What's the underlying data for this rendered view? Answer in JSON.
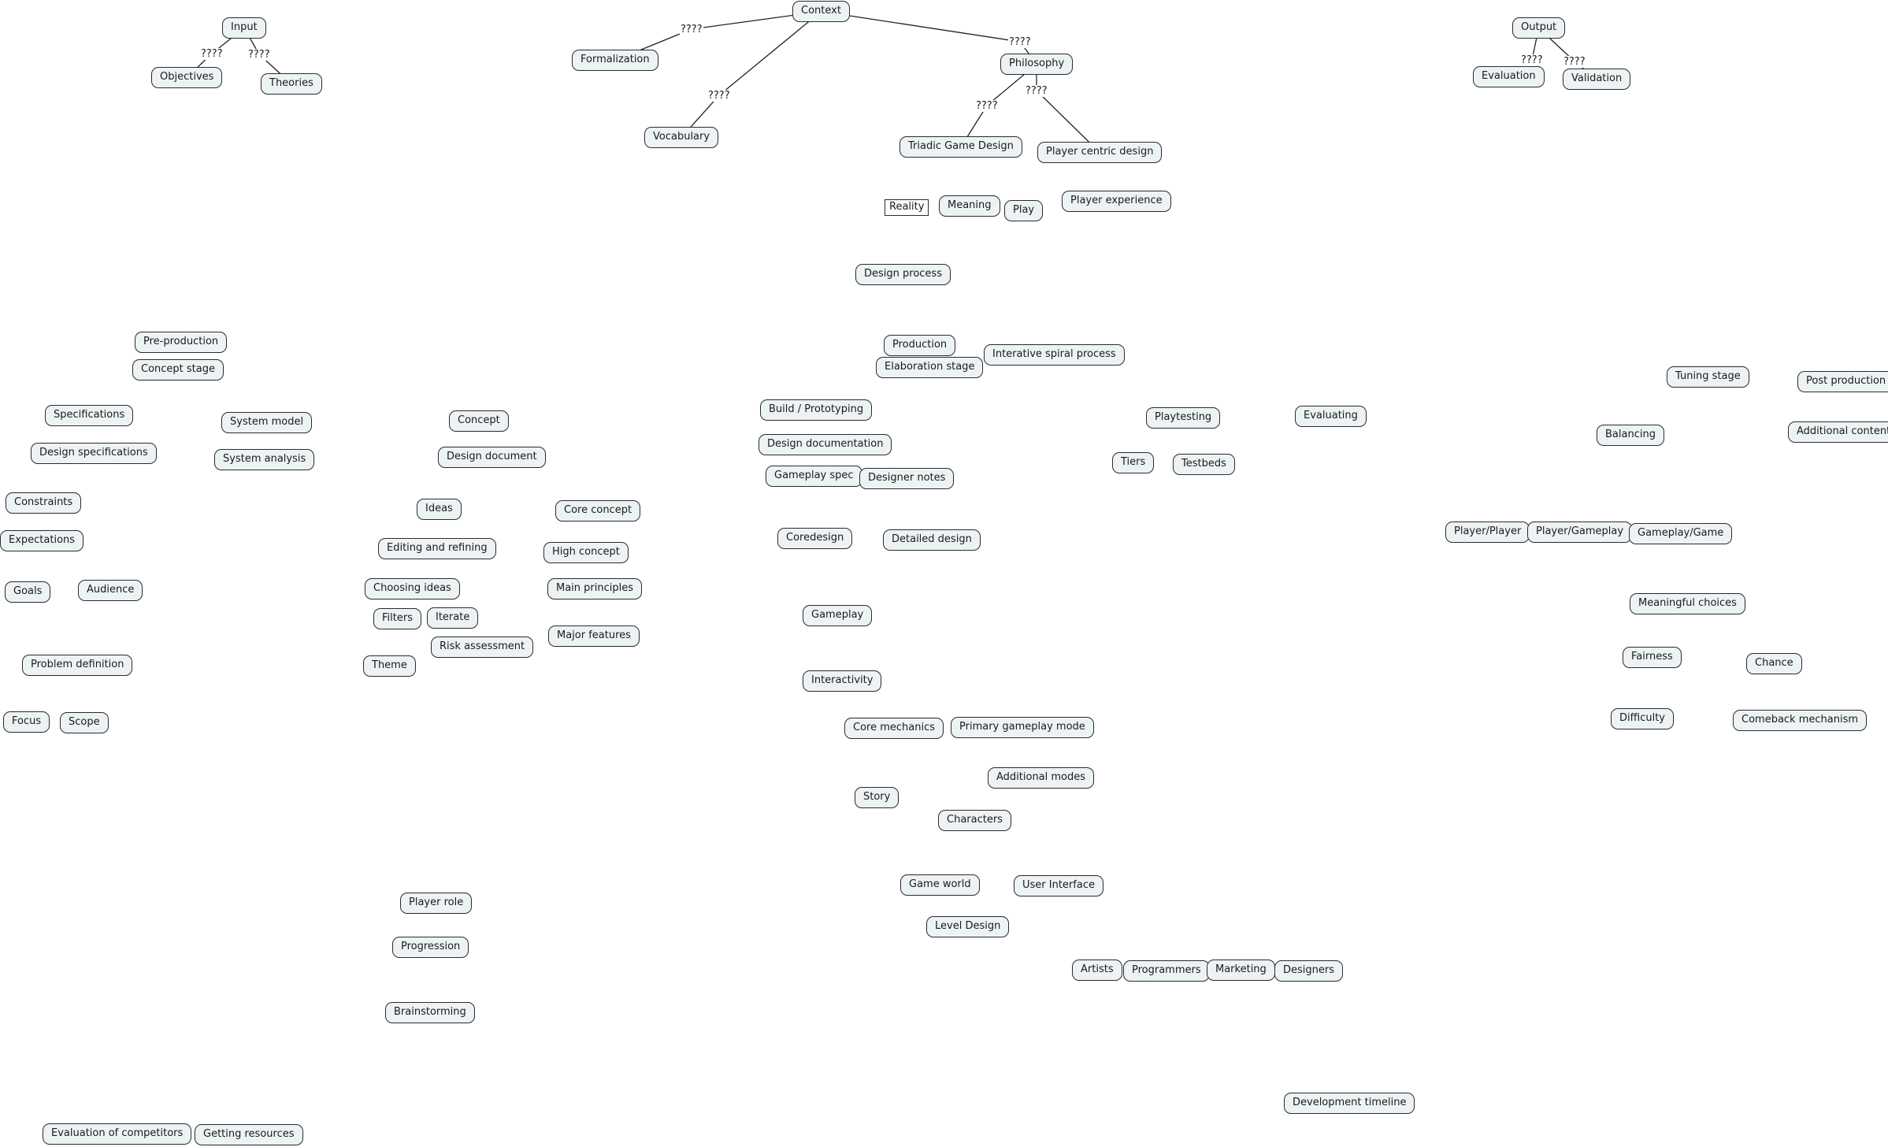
{
  "diagram": {
    "type": "concept-map",
    "link_label_text": "????",
    "colors": {
      "node_fill": "#edf3f5",
      "node_border": "#2b2b2b",
      "text": "#1a1a1a",
      "background": "#ffffff"
    },
    "nodes": [
      {
        "id": "input",
        "label": "Input"
      },
      {
        "id": "objectives",
        "label": "Objectives"
      },
      {
        "id": "theories",
        "label": "Theories"
      },
      {
        "id": "context",
        "label": "Context"
      },
      {
        "id": "formalization",
        "label": "Formalization"
      },
      {
        "id": "vocabulary",
        "label": "Vocabulary"
      },
      {
        "id": "philosophy",
        "label": "Philosophy"
      },
      {
        "id": "triadic",
        "label": "Triadic Game Design"
      },
      {
        "id": "player-centric",
        "label": "Player centric design"
      },
      {
        "id": "reality",
        "label": "Reality",
        "shape": "square"
      },
      {
        "id": "meaning",
        "label": "Meaning"
      },
      {
        "id": "play",
        "label": "Play"
      },
      {
        "id": "player-experience",
        "label": "Player experience"
      },
      {
        "id": "design-process",
        "label": "Design process"
      },
      {
        "id": "output",
        "label": "Output"
      },
      {
        "id": "evaluation",
        "label": "Evaluation"
      },
      {
        "id": "validation",
        "label": "Validation"
      },
      {
        "id": "pre-production",
        "label": "Pre-production"
      },
      {
        "id": "concept-stage",
        "label": "Concept stage"
      },
      {
        "id": "specifications",
        "label": "Specifications"
      },
      {
        "id": "design-specifications",
        "label": "Design specifications"
      },
      {
        "id": "system-model",
        "label": "System model"
      },
      {
        "id": "system-analysis",
        "label": "System analysis"
      },
      {
        "id": "constraints",
        "label": "Constraints"
      },
      {
        "id": "expectations",
        "label": "Expectations"
      },
      {
        "id": "goals",
        "label": "Goals"
      },
      {
        "id": "audience",
        "label": "Audience"
      },
      {
        "id": "problem-definition",
        "label": "Problem definition"
      },
      {
        "id": "focus",
        "label": "Focus"
      },
      {
        "id": "scope",
        "label": "Scope"
      },
      {
        "id": "concept",
        "label": "Concept"
      },
      {
        "id": "design-document",
        "label": "Design document"
      },
      {
        "id": "ideas",
        "label": "Ideas"
      },
      {
        "id": "core-concept",
        "label": "Core concept"
      },
      {
        "id": "editing-refining",
        "label": "Editing and refining"
      },
      {
        "id": "high-concept",
        "label": "High concept"
      },
      {
        "id": "choosing-ideas",
        "label": "Choosing ideas"
      },
      {
        "id": "main-principles",
        "label": "Main principles"
      },
      {
        "id": "filters",
        "label": "Filters"
      },
      {
        "id": "iterate",
        "label": "Iterate"
      },
      {
        "id": "risk-assessment",
        "label": "Risk assessment"
      },
      {
        "id": "major-features",
        "label": "Major features"
      },
      {
        "id": "theme",
        "label": "Theme"
      },
      {
        "id": "production",
        "label": "Production"
      },
      {
        "id": "elaboration-stage",
        "label": "Elaboration stage"
      },
      {
        "id": "iterative-spiral",
        "label": "Interative spiral process"
      },
      {
        "id": "build-prototyping",
        "label": "Build / Prototyping"
      },
      {
        "id": "design-documentation",
        "label": "Design documentation"
      },
      {
        "id": "gameplay-spec",
        "label": "Gameplay spec"
      },
      {
        "id": "designer-notes",
        "label": "Designer notes"
      },
      {
        "id": "coredesign",
        "label": "Coredesign"
      },
      {
        "id": "detailed-design",
        "label": "Detailed design"
      },
      {
        "id": "playtesting",
        "label": "Playtesting"
      },
      {
        "id": "evaluating",
        "label": "Evaluating"
      },
      {
        "id": "tiers",
        "label": "Tiers"
      },
      {
        "id": "testbeds",
        "label": "Testbeds"
      },
      {
        "id": "tuning-stage",
        "label": "Tuning stage"
      },
      {
        "id": "post-production",
        "label": "Post production"
      },
      {
        "id": "balancing",
        "label": "Balancing"
      },
      {
        "id": "additional-content",
        "label": "Additional content"
      },
      {
        "id": "player-player",
        "label": "Player/Player"
      },
      {
        "id": "player-gameplay",
        "label": "Player/Gameplay"
      },
      {
        "id": "gameplay-game",
        "label": "Gameplay/Game"
      },
      {
        "id": "meaningful-choices",
        "label": "Meaningful choices"
      },
      {
        "id": "fairness",
        "label": "Fairness"
      },
      {
        "id": "chance",
        "label": "Chance"
      },
      {
        "id": "difficulty",
        "label": "Difficulty"
      },
      {
        "id": "comeback-mechanism",
        "label": "Comeback mechanism"
      },
      {
        "id": "gameplay",
        "label": "Gameplay"
      },
      {
        "id": "interactivity",
        "label": "Interactivity"
      },
      {
        "id": "core-mechanics",
        "label": "Core mechanics"
      },
      {
        "id": "primary-gameplay-mode",
        "label": "Primary gameplay mode"
      },
      {
        "id": "additional-modes",
        "label": "Additional modes"
      },
      {
        "id": "story",
        "label": "Story"
      },
      {
        "id": "characters",
        "label": "Characters"
      },
      {
        "id": "game-world",
        "label": "Game world"
      },
      {
        "id": "user-interface",
        "label": "User Interface"
      },
      {
        "id": "level-design",
        "label": "Level Design"
      },
      {
        "id": "artists",
        "label": "Artists"
      },
      {
        "id": "programmers",
        "label": "Programmers"
      },
      {
        "id": "marketing",
        "label": "Marketing"
      },
      {
        "id": "designers",
        "label": "Designers"
      },
      {
        "id": "player-role",
        "label": "Player role"
      },
      {
        "id": "progression",
        "label": "Progression"
      },
      {
        "id": "brainstorming",
        "label": "Brainstorming"
      },
      {
        "id": "development-timeline",
        "label": "Development timeline"
      },
      {
        "id": "evaluation-competitors",
        "label": "Evaluation of competitors"
      },
      {
        "id": "getting-resources",
        "label": "Getting resources"
      }
    ],
    "links": [
      {
        "from": "input",
        "to": "objectives",
        "label": "????"
      },
      {
        "from": "input",
        "to": "theories",
        "label": "????"
      },
      {
        "from": "context",
        "to": "formalization",
        "label": "????"
      },
      {
        "from": "context",
        "to": "vocabulary",
        "label": "????"
      },
      {
        "from": "context",
        "to": "philosophy",
        "label": "????"
      },
      {
        "from": "philosophy",
        "to": "triadic",
        "label": "????"
      },
      {
        "from": "philosophy",
        "to": "player-centric",
        "label": "????"
      },
      {
        "from": "output",
        "to": "evaluation",
        "label": "????"
      },
      {
        "from": "output",
        "to": "validation",
        "label": "????"
      }
    ]
  }
}
